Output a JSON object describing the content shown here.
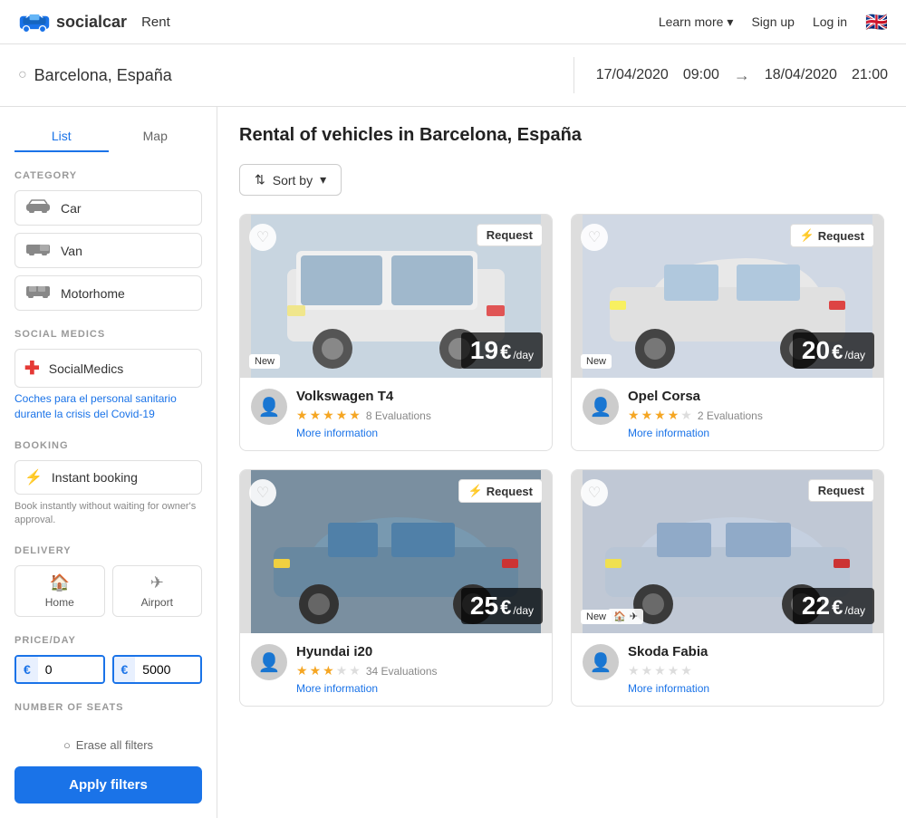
{
  "header": {
    "logo_text": "socialcar",
    "nav_rent": "Rent",
    "learn_more": "Learn more",
    "sign_up": "Sign up",
    "log_in": "Log in",
    "flag": "🇬🇧"
  },
  "search": {
    "location": "Barcelona, España",
    "date_from": "17/04/2020",
    "time_from": "09:00",
    "date_to": "18/04/2020",
    "time_to": "21:00"
  },
  "sidebar": {
    "tab_list": "List",
    "tab_map": "Map",
    "category_label": "CATEGORY",
    "categories": [
      {
        "id": "car",
        "label": "Car",
        "icon": "🚗"
      },
      {
        "id": "van",
        "label": "Van",
        "icon": "🚐"
      },
      {
        "id": "motorhome",
        "label": "Motorhome",
        "icon": "🚌"
      }
    ],
    "social_medics_label": "SOCIAL MEDICS",
    "social_medics_text": "SocialMedics",
    "social_medics_link": "Coches para el personal sanitario durante la crisis del Covid-19",
    "booking_label": "BOOKING",
    "instant_booking": "Instant booking",
    "booking_note": "Book instantly without waiting for owner's approval.",
    "delivery_label": "DELIVERY",
    "delivery_home": "Home",
    "delivery_airport": "Airport",
    "price_label": "PRICE/DAY",
    "price_min": "0",
    "price_max": "5000",
    "seats_label": "NUMBER OF SEATS",
    "erase_filters": "Erase all filters",
    "apply_filters": "Apply filters"
  },
  "content": {
    "title": "Rental of vehicles in Barcelona, España",
    "sort_label": "Sort by",
    "cars": [
      {
        "id": 1,
        "name": "Volkswagen T4",
        "price": "19",
        "per_day": "€/day",
        "badge": "Request",
        "badge_instant": false,
        "is_new": true,
        "evaluations": "8 Evaluations",
        "stars": 5,
        "more_info": "More information",
        "avatar_icon": "👤",
        "bg_class": "car1-bg"
      },
      {
        "id": 2,
        "name": "Opel Corsa",
        "price": "20",
        "per_day": "€/day",
        "badge": "Request",
        "badge_instant": true,
        "is_new": true,
        "evaluations": "2 Evaluations",
        "stars": 4,
        "more_info": "More information",
        "avatar_icon": "👤",
        "bg_class": "car2-bg"
      },
      {
        "id": 3,
        "name": "Hyundai i20",
        "price": "25",
        "per_day": "€/day",
        "badge": "Request",
        "badge_instant": true,
        "is_new": false,
        "evaluations": "34 Evaluations",
        "stars": 3,
        "more_info": "More information",
        "avatar_icon": "👤",
        "bg_class": "car3-bg"
      },
      {
        "id": 4,
        "name": "Skoda Fabia",
        "price": "22",
        "per_day": "€/day",
        "badge": "Request",
        "badge_instant": false,
        "is_new": true,
        "evaluations": "",
        "stars": 0,
        "more_info": "More information",
        "avatar_icon": "👤",
        "bg_class": "car4-bg"
      }
    ]
  }
}
